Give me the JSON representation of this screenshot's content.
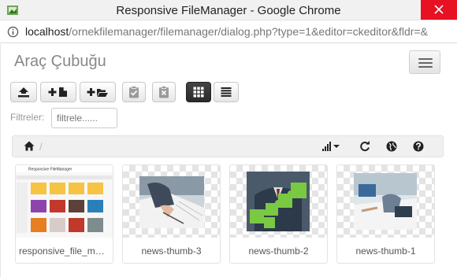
{
  "window": {
    "title": "Responsive FileManager - Google Chrome"
  },
  "address_bar": {
    "host": "localhost",
    "path": "/ornekfilemanager/filemanager/dialog.php?type=1&editor=ckeditor&fldr=&"
  },
  "toolbar": {
    "heading": "Araç Çubuğu",
    "buttons": [
      {
        "name": "upload",
        "icon": "upload-icon"
      },
      {
        "name": "new-file",
        "icon": "new-file-icon"
      },
      {
        "name": "new-folder",
        "icon": "new-folder-icon"
      },
      {
        "name": "paste",
        "icon": "clipboard-check-icon"
      },
      {
        "name": "clear-clipboard",
        "icon": "clipboard-x-icon"
      },
      {
        "name": "view-grid",
        "icon": "grid-icon",
        "active": true
      },
      {
        "name": "view-list",
        "icon": "list-icon"
      }
    ],
    "filter_label": "Filtreler:",
    "filter_placeholder": "filtrele......"
  },
  "breadcrumb": {
    "home_icon": "home-icon",
    "separator": "/",
    "actions": [
      "sort-icon",
      "refresh-icon",
      "language-icon",
      "help-icon"
    ]
  },
  "files": [
    {
      "name": "responsive_file_man...",
      "type": "image"
    },
    {
      "name": "news-thumb-3",
      "type": "image"
    },
    {
      "name": "news-thumb-2",
      "type": "image"
    },
    {
      "name": "news-thumb-1",
      "type": "image"
    }
  ],
  "colors": {
    "close_button": "#e81123",
    "active_button": "#333333"
  }
}
